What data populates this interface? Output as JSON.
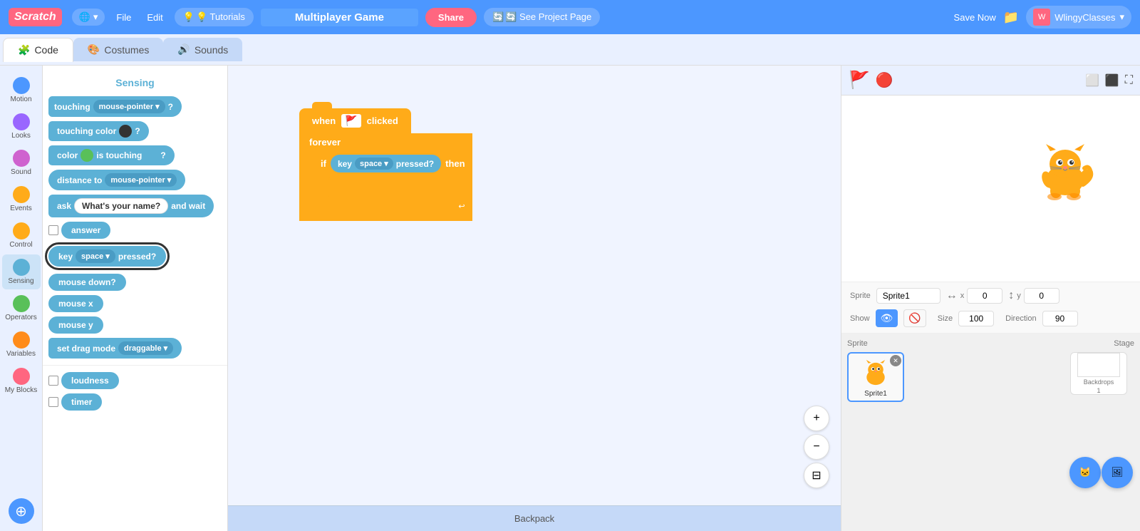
{
  "topNav": {
    "logo": "Scratch",
    "globe_label": "🌐",
    "file_label": "File",
    "edit_label": "Edit",
    "tutorials_label": "💡 Tutorials",
    "project_name": "Multiplayer Game",
    "share_label": "Share",
    "see_project_label": "🔄 See Project Page",
    "save_now_label": "Save Now",
    "folder_icon": "📁",
    "user_avatar": "W",
    "user_name": "WlingyClasses",
    "chevron": "▾"
  },
  "tabs": {
    "code_label": "Code",
    "costumes_label": "Costumes",
    "sounds_label": "Sounds"
  },
  "sidebar": {
    "items": [
      {
        "label": "Motion",
        "color": "#4c97ff"
      },
      {
        "label": "Looks",
        "color": "#9966ff"
      },
      {
        "label": "Sound",
        "color": "#cf63cf"
      },
      {
        "label": "Events",
        "color": "#ffab19"
      },
      {
        "label": "Control",
        "color": "#ffab19"
      },
      {
        "label": "Sensing",
        "color": "#5cb1d6"
      },
      {
        "label": "Operators",
        "color": "#59c059"
      },
      {
        "label": "Variables",
        "color": "#ff8c1a"
      },
      {
        "label": "My Blocks",
        "color": "#ff6680"
      }
    ]
  },
  "blocksPanel": {
    "category": "Sensing",
    "blocks": [
      {
        "type": "touching",
        "text": "touching",
        "dropdown": "mouse-pointer"
      },
      {
        "type": "touching_color",
        "text": "touching color"
      },
      {
        "type": "color_touching",
        "text": "color  is touching"
      },
      {
        "type": "distance_to",
        "text": "distance to",
        "dropdown": "mouse-pointer"
      },
      {
        "type": "ask",
        "text": "ask",
        "input": "What's your name?",
        "suffix": "and wait"
      },
      {
        "type": "answer",
        "text": "answer"
      },
      {
        "type": "key_pressed",
        "text": "key",
        "dropdown": "space",
        "suffix": "pressed?",
        "highlighted": true
      },
      {
        "type": "mouse_down",
        "text": "mouse down?"
      },
      {
        "type": "mouse_x",
        "text": "mouse x"
      },
      {
        "type": "mouse_y",
        "text": "mouse y"
      },
      {
        "type": "set_drag",
        "text": "set drag mode",
        "dropdown": "draggable"
      },
      {
        "type": "loudness",
        "text": "loudness"
      },
      {
        "type": "timer",
        "text": "timer"
      }
    ]
  },
  "canvas": {
    "blocks": {
      "hat_text": "when",
      "hat_suffix": "clicked",
      "forever_text": "forever",
      "if_text": "if",
      "key_text": "key",
      "space_text": "space",
      "pressed_text": "pressed?",
      "then_text": "then"
    }
  },
  "stage": {
    "sprite_label": "Sprite",
    "sprite_name": "Sprite1",
    "x_label": "x",
    "x_value": "0",
    "y_label": "y",
    "y_value": "0",
    "show_label": "Show",
    "size_label": "Size",
    "size_value": "100",
    "direction_label": "Direction",
    "direction_value": "90"
  },
  "spritesPanel": {
    "sprite1_name": "Sprite1",
    "stage_label": "Stage",
    "backdrops_label": "Backdrops",
    "backdrops_count": "1"
  },
  "backpack": {
    "label": "Backpack"
  },
  "zoomControls": {
    "zoom_in": "+",
    "zoom_out": "−",
    "fit": "⊟"
  }
}
